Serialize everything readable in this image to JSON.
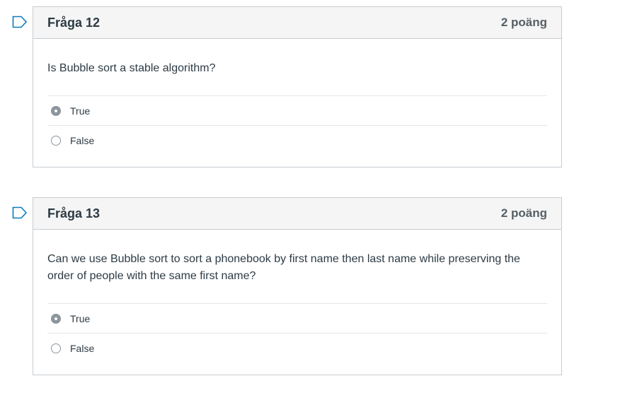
{
  "questions": [
    {
      "title": "Fråga 12",
      "points": "2 poäng",
      "text": "Is Bubble sort a stable algorithm?",
      "answers": [
        {
          "label": "True",
          "selected": true
        },
        {
          "label": "False",
          "selected": false
        }
      ]
    },
    {
      "title": "Fråga 13",
      "points": "2 poäng",
      "text": "Can we use Bubble sort to sort a phonebook by first name then last name while preserving the order of people with the same first name?",
      "answers": [
        {
          "label": "True",
          "selected": true
        },
        {
          "label": "False",
          "selected": false
        }
      ]
    }
  ],
  "colors": {
    "flag": "#0b7bbf",
    "radio_selected": "#8b969e",
    "header_bg": "#f5f5f5",
    "border": "#c7cdd1"
  },
  "icons": {
    "flag": "flag-outline-icon"
  }
}
